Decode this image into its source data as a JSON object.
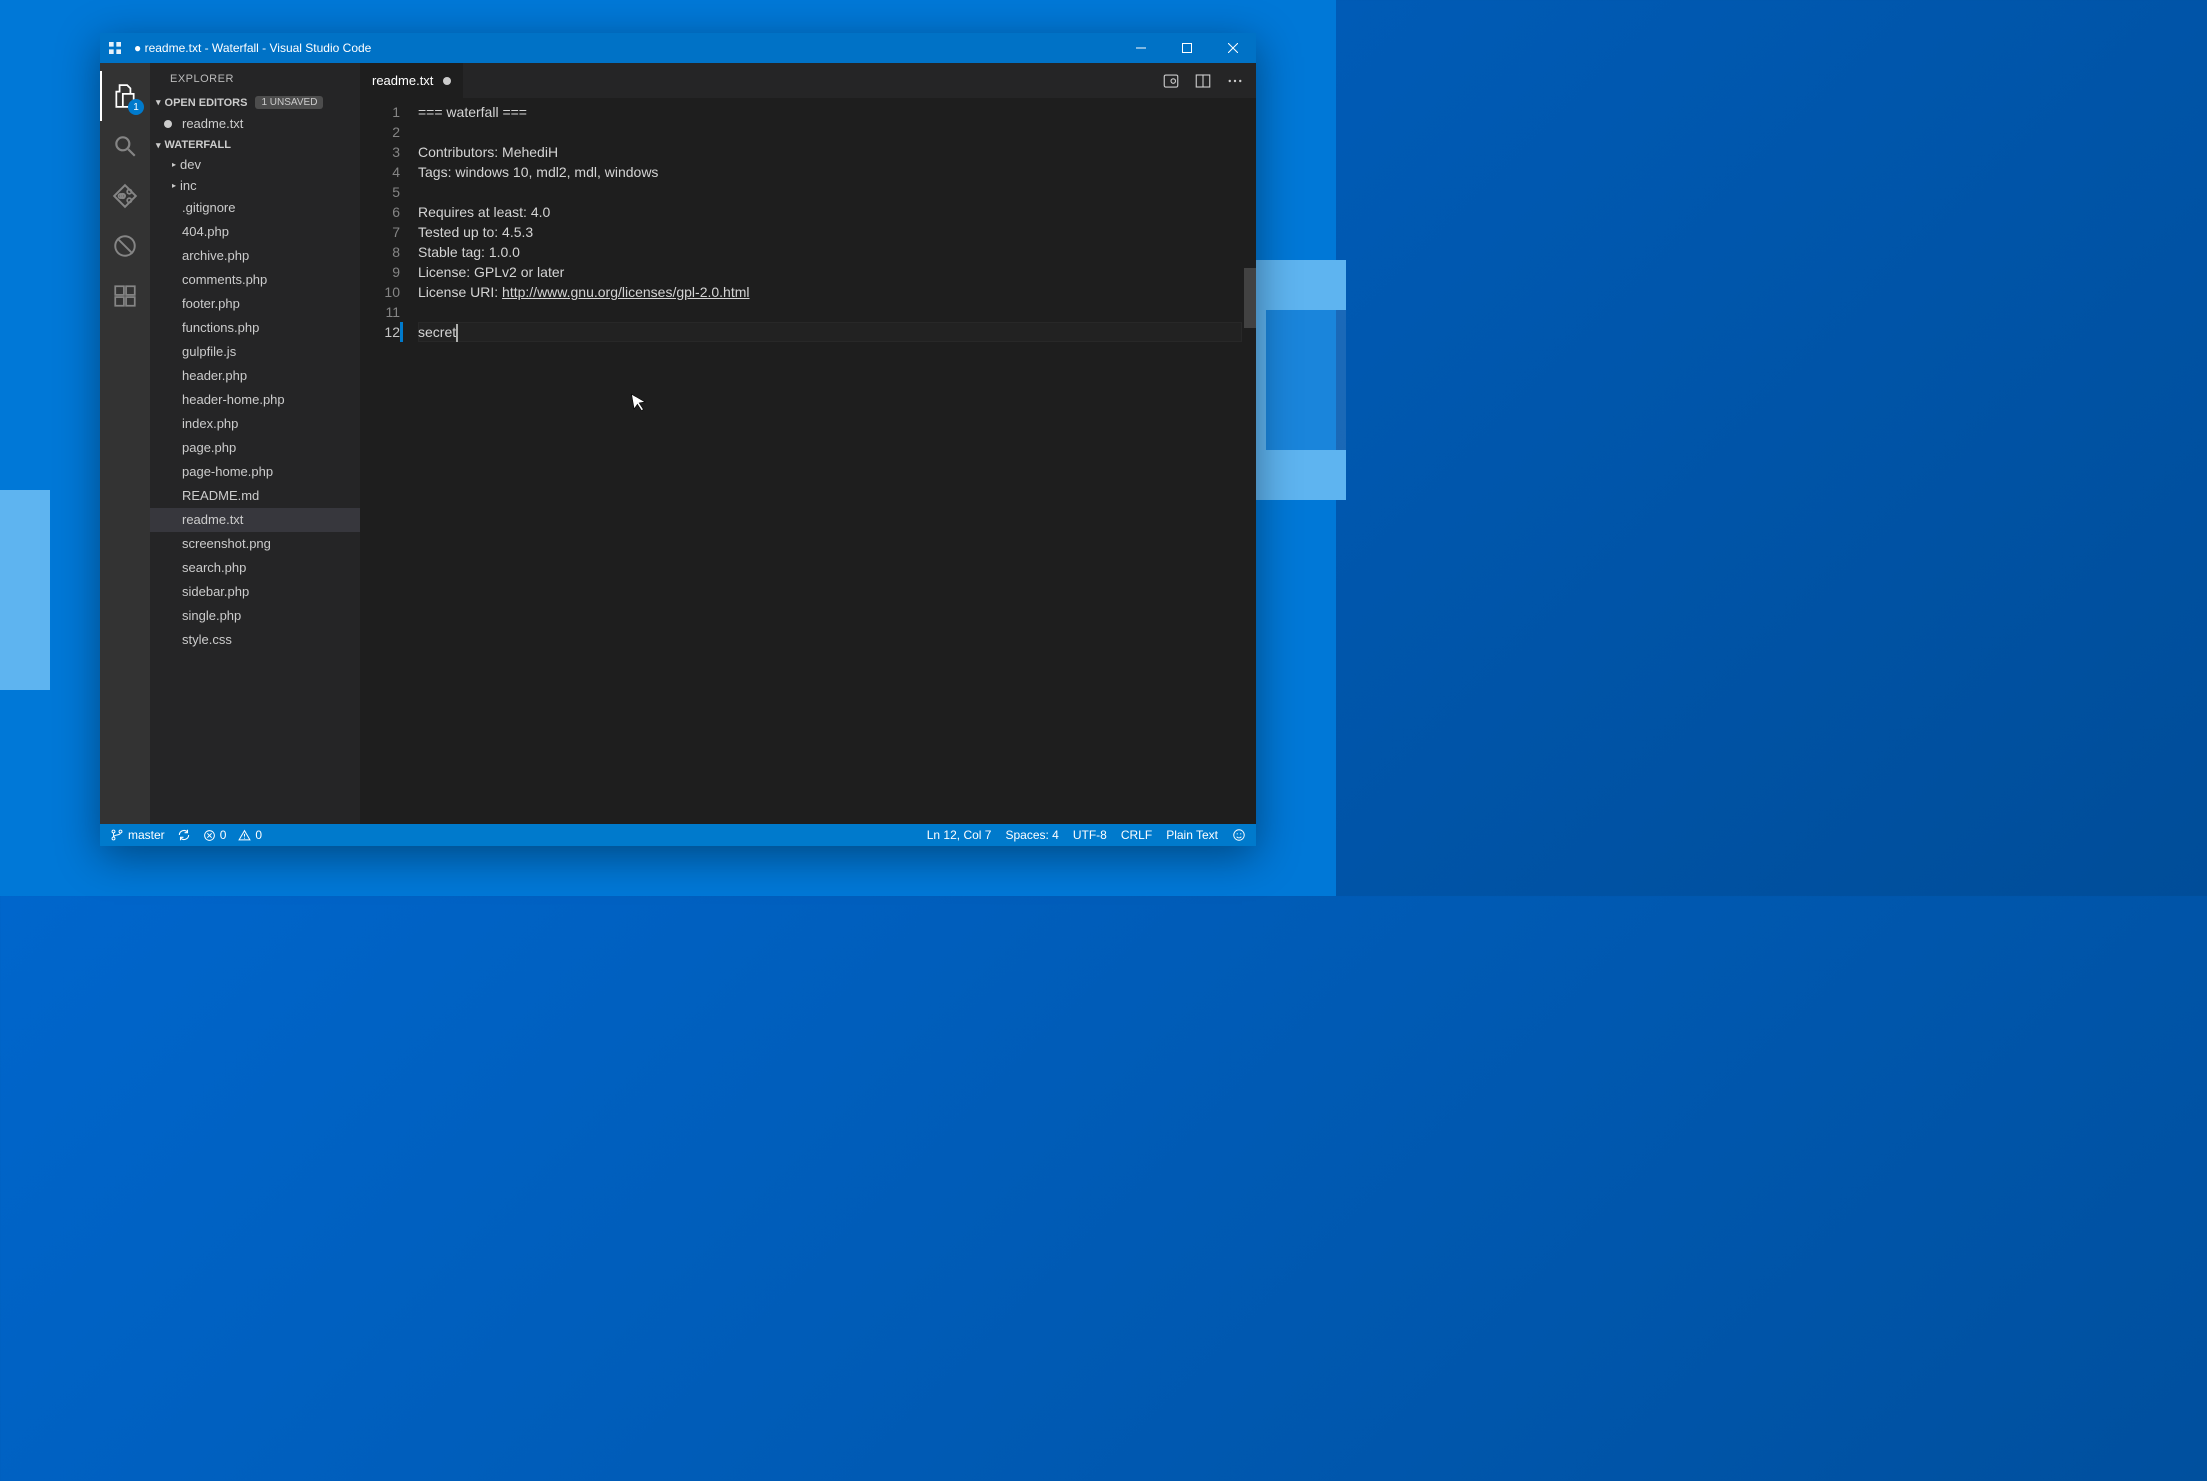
{
  "window": {
    "title": "● readme.txt - Waterfall - Visual Studio Code"
  },
  "activitybar": {
    "explorer_badge": "1"
  },
  "sidebar": {
    "title": "EXPLORER",
    "open_editors": {
      "label": "OPEN EDITORS",
      "unsaved": "1 UNSAVED",
      "items": [
        {
          "name": "readme.txt",
          "dirty": true
        }
      ]
    },
    "workspace": {
      "name": "WATERFALL",
      "folders": [
        {
          "name": "dev"
        },
        {
          "name": "inc"
        }
      ],
      "files": [
        ".gitignore",
        "404.php",
        "archive.php",
        "comments.php",
        "footer.php",
        "functions.php",
        "gulpfile.js",
        "header.php",
        "header-home.php",
        "index.php",
        "page.php",
        "page-home.php",
        "README.md",
        "readme.txt",
        "screenshot.png",
        "search.php",
        "sidebar.php",
        "single.php",
        "style.css"
      ],
      "active_file": "readme.txt"
    }
  },
  "editor": {
    "tab": {
      "name": "readme.txt",
      "dirty": true
    },
    "lines": [
      "=== waterfall ===",
      "",
      "Contributors: MehediH",
      "Tags: windows 10, mdl2, mdl, windows",
      "",
      "Requires at least: 4.0",
      "Tested up to: 4.5.3",
      "Stable tag: 1.0.0",
      "License: GPLv2 or later",
      "License URI: http://www.gnu.org/licenses/gpl-2.0.html",
      "",
      "secret"
    ],
    "link_line_index": 9,
    "link_prefix": "License URI: ",
    "link_text": "http://www.gnu.org/licenses/gpl-2.0.html",
    "active_line": 12
  },
  "statusbar": {
    "branch": "master",
    "errors": "0",
    "warnings": "0",
    "position": "Ln 12, Col 7",
    "spaces": "Spaces: 4",
    "encoding": "UTF-8",
    "eol": "CRLF",
    "language": "Plain Text"
  }
}
